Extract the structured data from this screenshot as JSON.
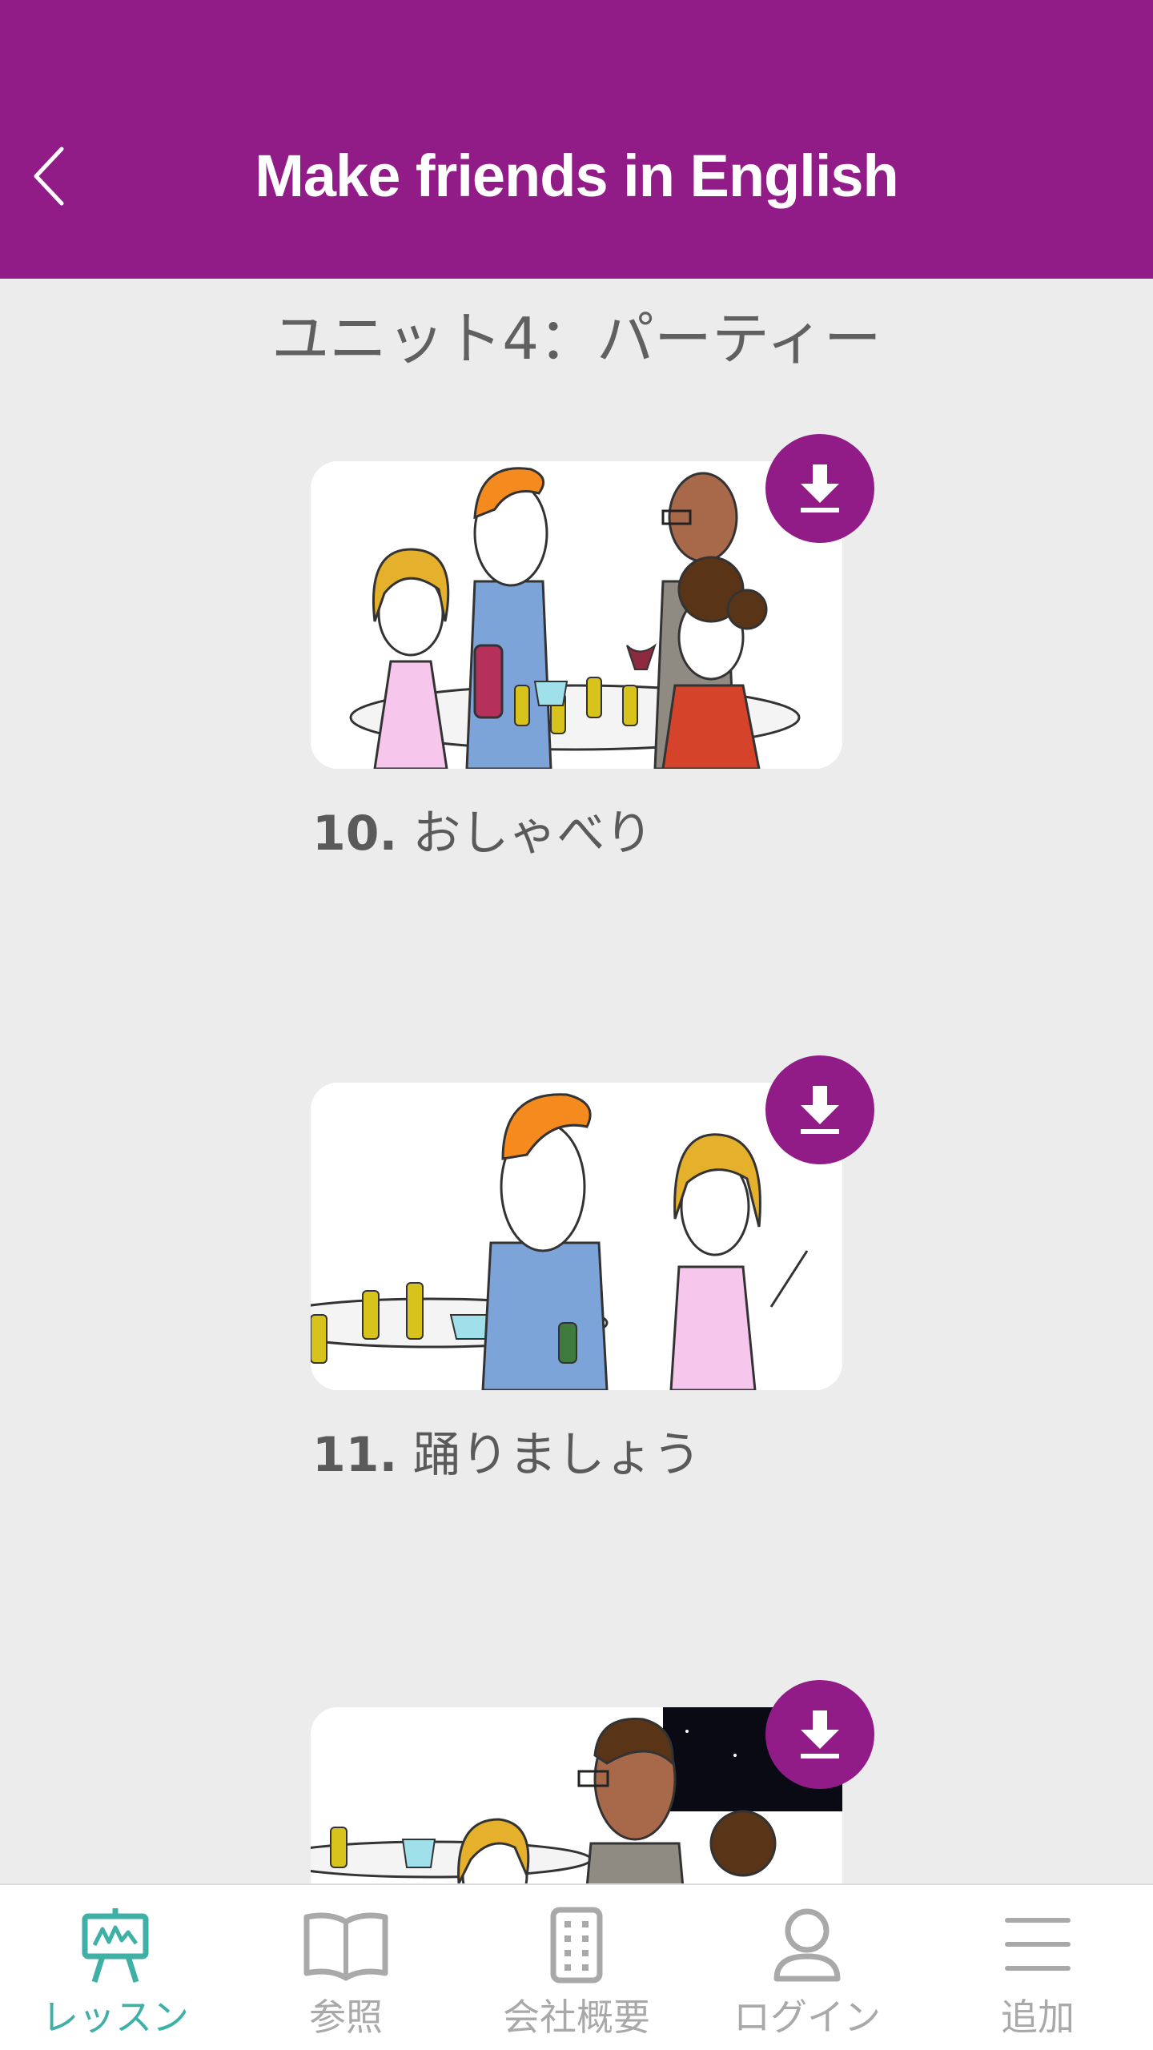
{
  "header": {
    "title": "Make friends in English",
    "back_icon": "chevron-left-icon",
    "color": "#921c87"
  },
  "unit": {
    "title": "ユニット4：パーティー"
  },
  "lessons": [
    {
      "number": "10.",
      "title": "おしゃべり",
      "download_icon": "download-icon"
    },
    {
      "number": "11.",
      "title": "踊りましょう",
      "download_icon": "download-icon"
    },
    {
      "number": "",
      "title": "",
      "download_icon": "download-icon"
    }
  ],
  "tabbar": {
    "active_color": "#3fb0a6",
    "inactive_color": "#a9a9a9",
    "tabs": [
      {
        "label": "レッスン",
        "icon": "lesson-easel-icon",
        "active": true
      },
      {
        "label": "参照",
        "icon": "book-icon",
        "active": false
      },
      {
        "label": "会社概要",
        "icon": "building-icon",
        "active": false
      },
      {
        "label": "ログイン",
        "icon": "user-icon",
        "active": false
      },
      {
        "label": "追加",
        "icon": "menu-icon",
        "active": false
      }
    ]
  }
}
